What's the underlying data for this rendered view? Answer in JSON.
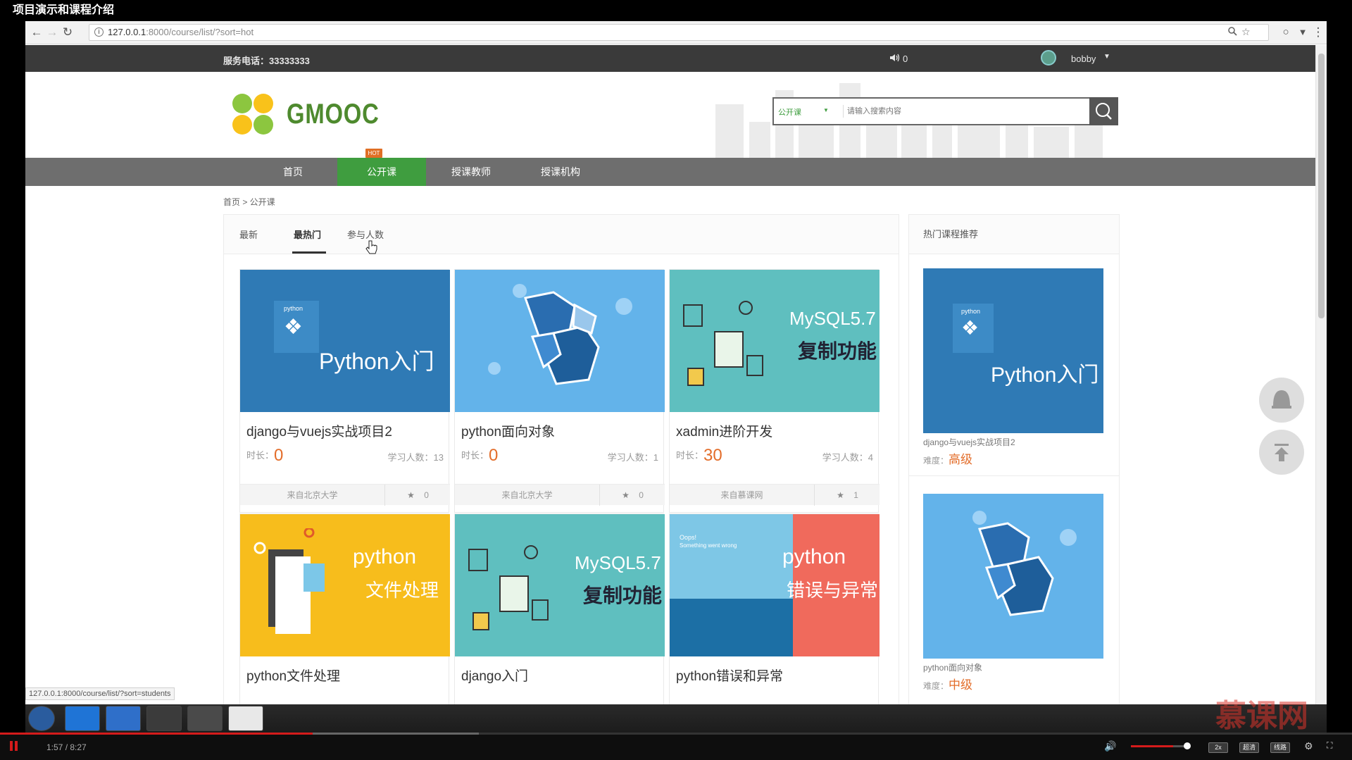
{
  "video": {
    "title": "项目演示和课程介绍",
    "time": "1:57 / 8:27",
    "progress": 0.231,
    "buttons": [
      "2x",
      "超清",
      "线路"
    ],
    "volume": 0.75
  },
  "browser": {
    "url_host": "127.0.0.1",
    "url_rest": ":8000/course/list/?sort=hot",
    "status_url": "127.0.0.1:8000/course/list/?sort=students"
  },
  "topbar": {
    "phone": "服务电话：33333333",
    "message_count": "0",
    "username": "bobby"
  },
  "header": {
    "logo_text": "GMOOC",
    "search_category": "公开课",
    "search_placeholder": "请输入搜索内容"
  },
  "nav": {
    "items": [
      "首页",
      "公开课",
      "授课教师",
      "授课机构"
    ],
    "hot_badge": "HOT"
  },
  "breadcrumb": "首页 > 公开课",
  "sort_tabs": [
    "最新",
    "最热门",
    "参与人数"
  ],
  "labels": {
    "duration": "时长：",
    "students": "学习人数：",
    "level": "难度："
  },
  "courses": [
    {
      "title": "django与vuejs实战项目2",
      "duration": "0",
      "students": "13",
      "org": "来自北京大学",
      "favs": "0",
      "thumb": "python-intro"
    },
    {
      "title": "python面向对象",
      "duration": "0",
      "students": "1",
      "org": "来自北京大学",
      "favs": "0",
      "thumb": "python-oop"
    },
    {
      "title": "xadmin进阶开发",
      "duration": "30",
      "students": "4",
      "org": "来自慕课网",
      "favs": "1",
      "thumb": "mysql"
    },
    {
      "title": "python文件处理",
      "thumb": "python-file"
    },
    {
      "title": "django入门",
      "thumb": "mysql"
    },
    {
      "title": "python错误和异常",
      "thumb": "python-error"
    }
  ],
  "thumb_text": {
    "python_small": "python",
    "python_intro": "Python入门",
    "mysql_brand": "MySQL5.7",
    "mysql_sub": "复制功能",
    "python_word": "python",
    "file_sub": "文件处理",
    "error_sub": "错误与异常",
    "oops": "Oops!",
    "oops_sub": "Something went wrong"
  },
  "side": {
    "title": "热门课程推荐",
    "items": [
      {
        "name": "django与vuejs实战项目2",
        "level": "高级"
      },
      {
        "name": "python面向对象",
        "level": "中级"
      }
    ]
  },
  "watermark": "慕课网",
  "colors": {
    "accent_green": "#3f9d3f",
    "nav_gray": "#6e6e6e",
    "topbar_dark": "#3a3a3a",
    "orange": "#e36d2a",
    "player_red": "#d41b1b"
  }
}
